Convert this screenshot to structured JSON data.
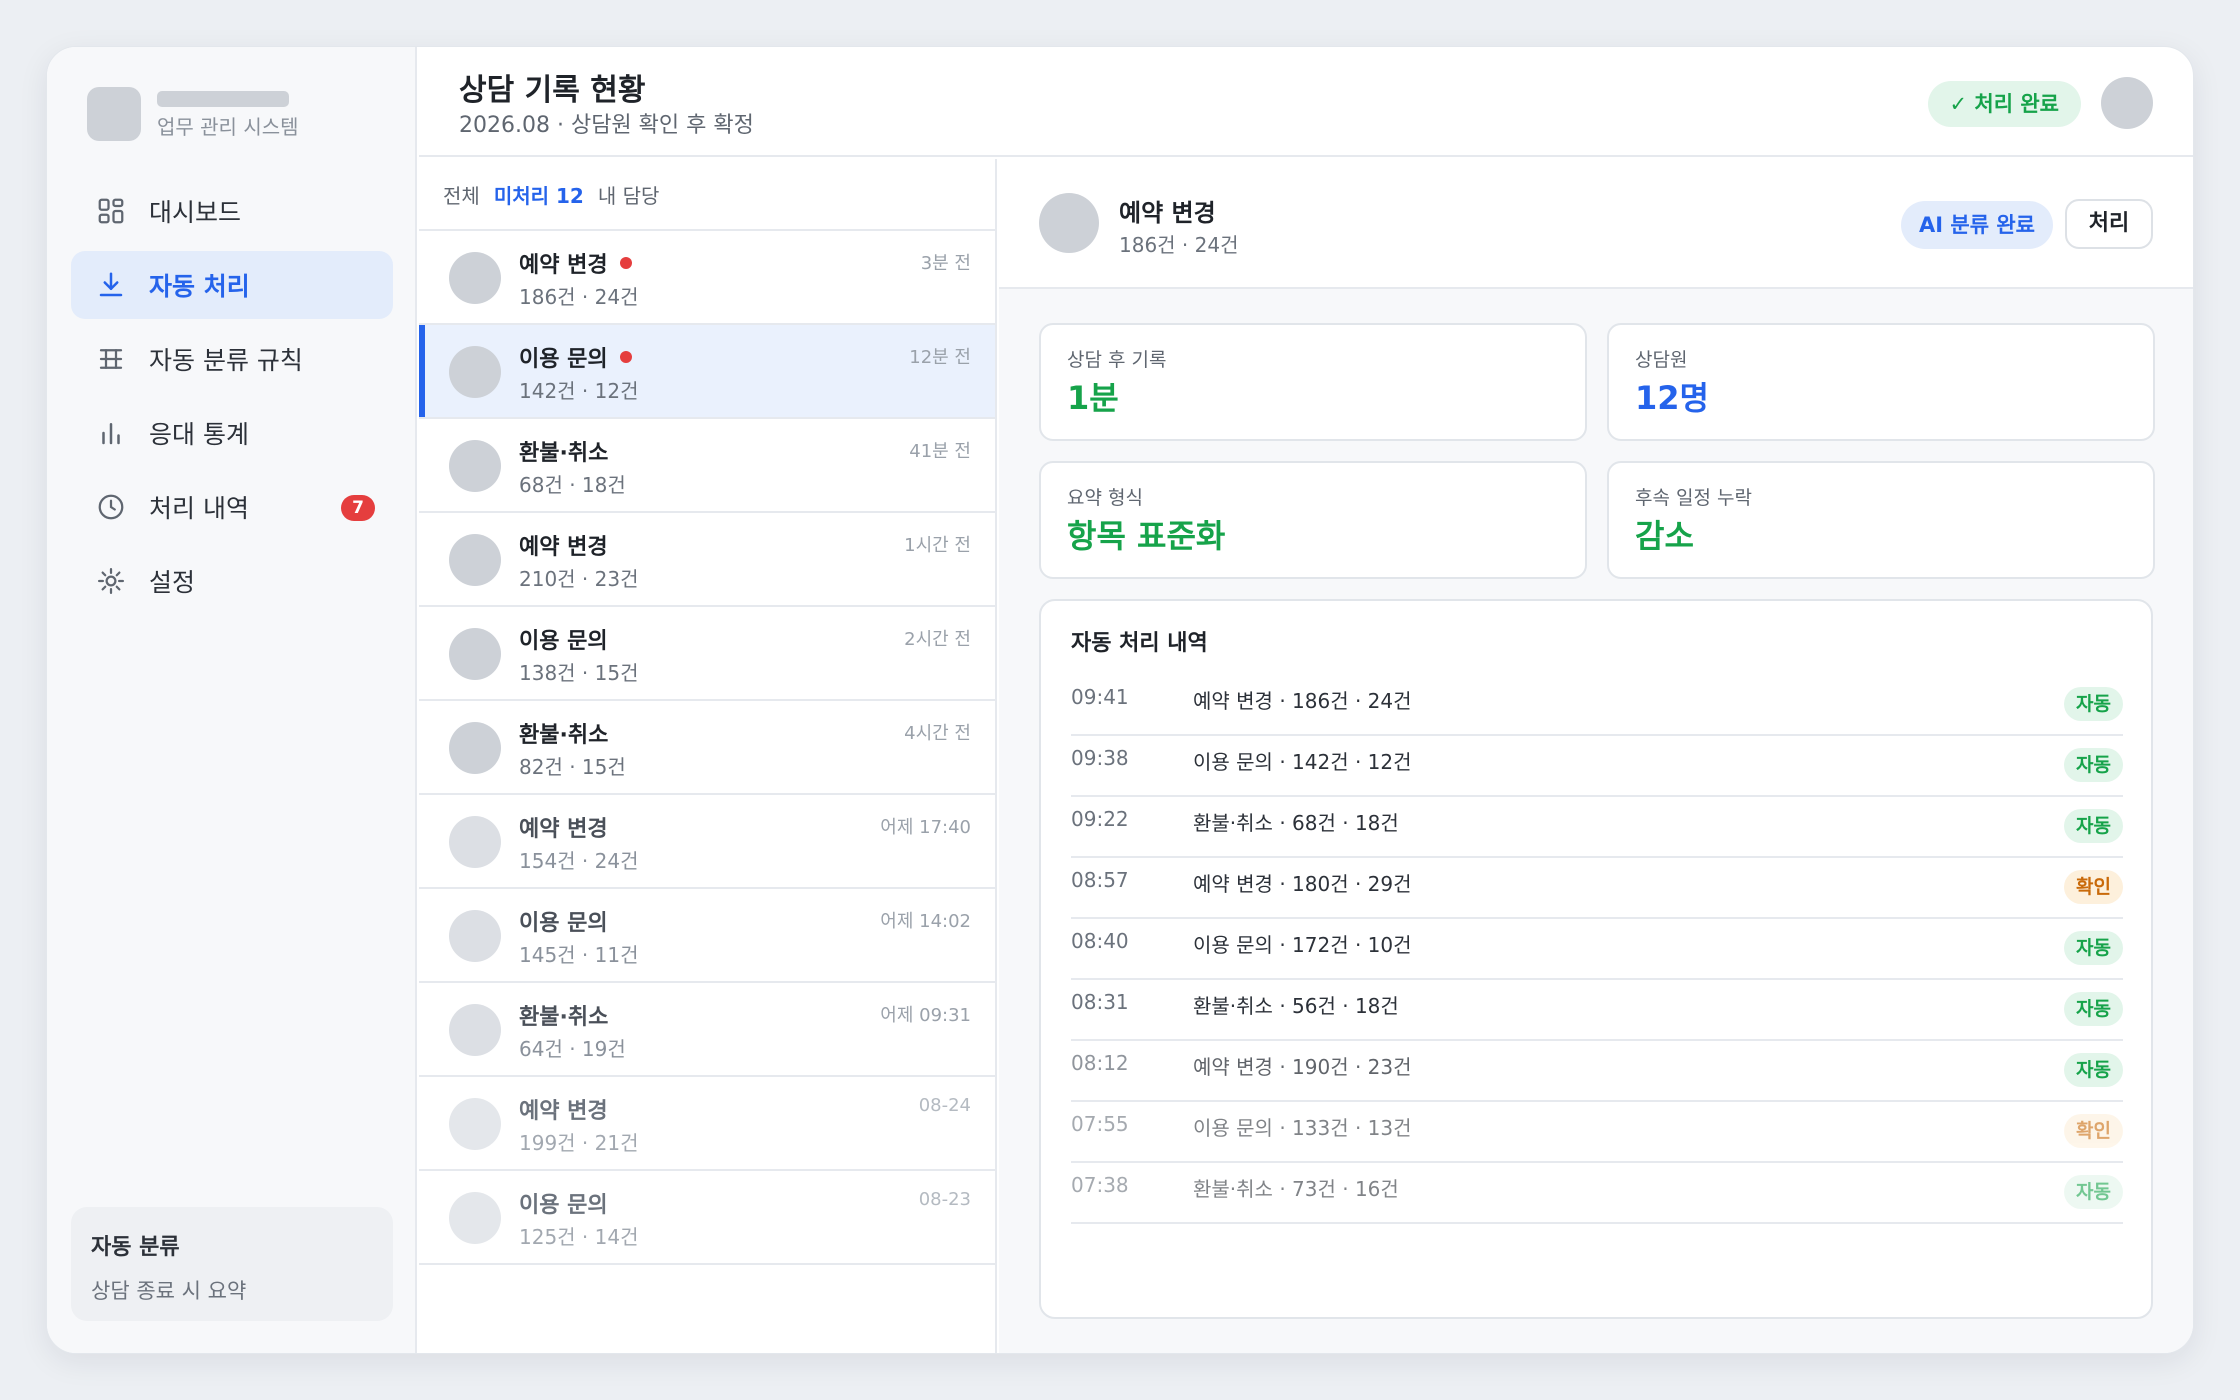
{
  "brand": {
    "subtitle": "업무 관리 시스템"
  },
  "sidebar": {
    "items": [
      {
        "label": "대시보드",
        "icon": "dashboard-grid-icon"
      },
      {
        "label": "자동 처리",
        "icon": "download-icon"
      },
      {
        "label": "자동 분류 규칙",
        "icon": "rules-grid-icon"
      },
      {
        "label": "응대 통계",
        "icon": "bar-chart-icon"
      },
      {
        "label": "처리 내역",
        "icon": "clock-icon",
        "badge": "7"
      },
      {
        "label": "설정",
        "icon": "gear-icon"
      }
    ],
    "card": {
      "title": "자동 분류",
      "subtitle": "상담 종료 시 요약"
    }
  },
  "header": {
    "title": "상담 기록 현황",
    "subtitle": "2026.08 · 상담원 확인 후 확정",
    "status_pill": "✓ 처리 완료"
  },
  "filters": {
    "all": "전체",
    "unprocessed": "미처리 12",
    "mine": "내 담당"
  },
  "list": [
    {
      "title": "예약 변경",
      "sub": "186건 · 24건",
      "time": "3분 전",
      "unread": true
    },
    {
      "title": "이용 문의",
      "sub": "142건 · 12건",
      "time": "12분 전",
      "unread": true
    },
    {
      "title": "환불·취소",
      "sub": "68건 · 18건",
      "time": "41분 전"
    },
    {
      "title": "예약 변경",
      "sub": "210건 · 23건",
      "time": "1시간 전"
    },
    {
      "title": "이용 문의",
      "sub": "138건 · 15건",
      "time": "2시간 전"
    },
    {
      "title": "환불·취소",
      "sub": "82건 · 15건",
      "time": "4시간 전"
    },
    {
      "title": "예약 변경",
      "sub": "154건 · 24건",
      "time": "어제 17:40"
    },
    {
      "title": "이용 문의",
      "sub": "145건 · 11건",
      "time": "어제 14:02"
    },
    {
      "title": "환불·취소",
      "sub": "64건 · 19건",
      "time": "어제 09:31"
    },
    {
      "title": "예약 변경",
      "sub": "199건 · 21건",
      "time": "08-24"
    },
    {
      "title": "이용 문의",
      "sub": "125건 · 14건",
      "time": "08-23"
    }
  ],
  "detail": {
    "title": "예약 변경",
    "subtitle": "186건 · 24건",
    "ai_pill": "AI 분류 완료",
    "process_button": "처리",
    "stats": [
      {
        "label": "상담 후 기록",
        "value": "1분",
        "color": "#16a34a"
      },
      {
        "label": "상담원",
        "value": "12명",
        "color": "#2563eb"
      },
      {
        "label": "요약 형식",
        "value": "항목 표준화",
        "color": "#16a34a"
      },
      {
        "label": "후속 일정 누락",
        "value": "감소",
        "color": "#16a34a"
      }
    ],
    "log_title": "자동 처리 내역",
    "log": [
      {
        "time": "09:41",
        "text": "예약 변경 · 186건 · 24건",
        "tag": "자동"
      },
      {
        "time": "09:38",
        "text": "이용 문의 · 142건 · 12건",
        "tag": "자동"
      },
      {
        "time": "09:22",
        "text": "환불·취소 · 68건 · 18건",
        "tag": "자동"
      },
      {
        "time": "08:57",
        "text": "예약 변경 · 180건 · 29건",
        "tag": "확인"
      },
      {
        "time": "08:40",
        "text": "이용 문의 · 172건 · 10건",
        "tag": "자동"
      },
      {
        "time": "08:31",
        "text": "환불·취소 · 56건 · 18건",
        "tag": "자동"
      },
      {
        "time": "08:12",
        "text": "예약 변경 · 190건 · 23건",
        "tag": "자동"
      },
      {
        "time": "07:55",
        "text": "이용 문의 · 133건 · 13건",
        "tag": "확인"
      },
      {
        "time": "07:38",
        "text": "환불·취소 · 73건 · 16건",
        "tag": "자동"
      }
    ]
  },
  "colors": {
    "accent": "#2563eb",
    "success": "#16a34a",
    "warning": "#c96a0a",
    "danger": "#e53e3e"
  }
}
